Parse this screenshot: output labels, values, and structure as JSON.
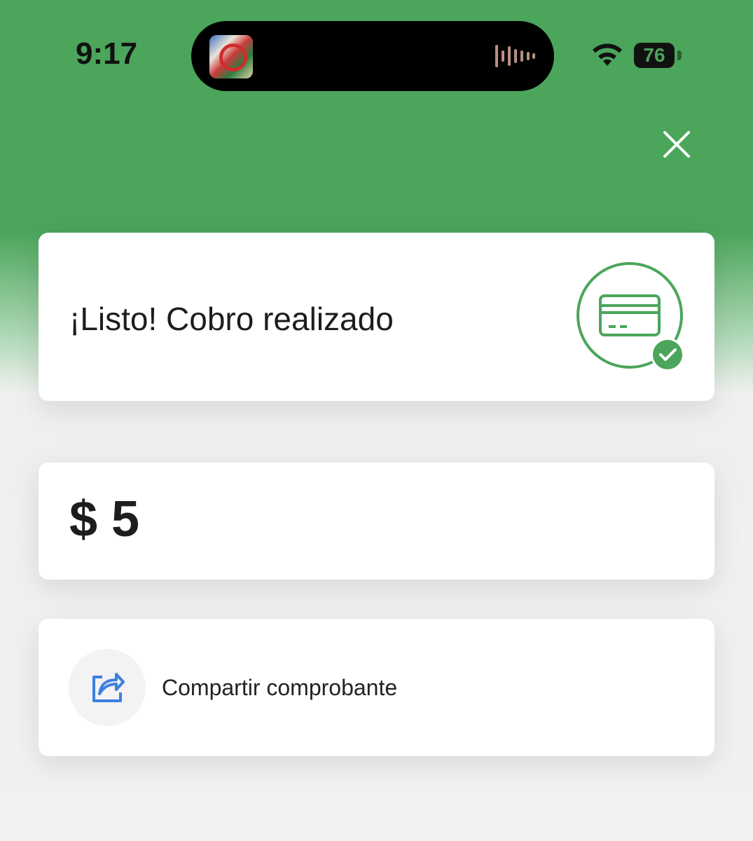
{
  "status_bar": {
    "time": "9:17",
    "battery": "76",
    "wifi_icon": "wifi-icon",
    "waveform_icon": "waveform-icon"
  },
  "header": {
    "close_icon": "close-icon",
    "background_color": "#4ba55b"
  },
  "result": {
    "title": "¡Listo! Cobro realizado",
    "icon": "card-check-icon",
    "accent_color": "#4ba55b"
  },
  "amount": {
    "text": "$ 5"
  },
  "share": {
    "label": "Compartir comprobante",
    "icon": "share-icon",
    "icon_color": "#3e7fe0"
  }
}
